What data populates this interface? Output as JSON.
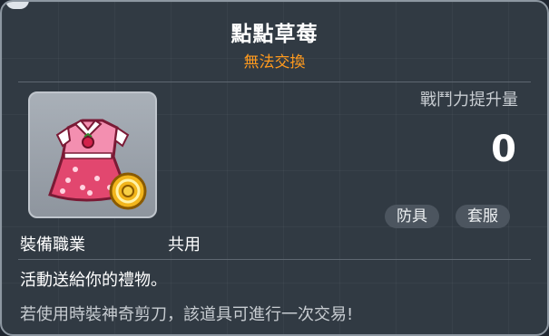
{
  "item": {
    "name": "點點草莓",
    "trade_status": "無法交換",
    "icon": "strawberry-polka-dot-dress-icon",
    "coin_badge": "gold-coin-icon"
  },
  "stats": {
    "power_label": "戰鬥力提升量",
    "power_value": "0"
  },
  "tags": {
    "armor": "防具",
    "set": "套服"
  },
  "requirements": {
    "job_label": "裝備職業",
    "job_value": "共用"
  },
  "description": {
    "line1": "活動送給你的禮物。",
    "line2": "若使用時裝神奇剪刀，該道具可進行一次交易!"
  },
  "colors": {
    "background": "#313a43",
    "trade_status": "#ff9a1e",
    "title": "#ffffff"
  }
}
